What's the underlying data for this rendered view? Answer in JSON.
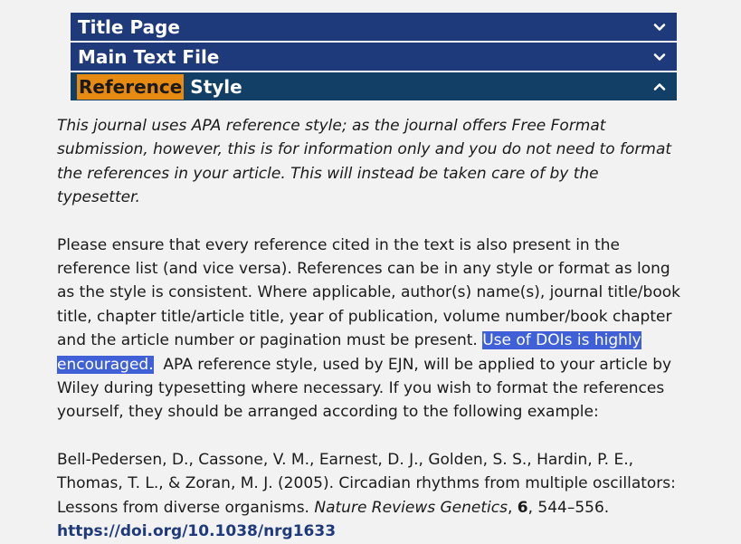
{
  "accordion": {
    "sections": [
      {
        "label": "Title Page",
        "state": "collapsed",
        "chevron": "chevron-down-icon"
      },
      {
        "label": "Main Text File",
        "state": "collapsed",
        "chevron": "chevron-down-icon"
      },
      {
        "label_highlight": "Reference",
        "label_rest": " Style",
        "state": "expanded",
        "chevron": "chevron-up-icon"
      }
    ]
  },
  "content": {
    "intro": "This journal uses APA reference style; as the journal offers Free Format submission, however, this is for information only and you do not need to format the references in your article. This will instead be taken care of by the typesetter.",
    "body_before": "Please ensure that every reference cited in the text is also present in the reference list (and vice versa). References can be in any style or format as long as the style is consistent. Where applicable, author(s) name(s), journal title/book title, chapter title/article title, year of publication, volume number/book chapter and the article number or pagination must be present. ",
    "body_highlight": "Use of DOIs is highly encouraged.",
    "body_after": "  APA reference style, used by EJN, will be applied to your article by Wiley during typesetting where necessary. If you wish to format the references yourself, they should be arranged according to the following example:",
    "reference": {
      "authors": "Bell-Pedersen, D., Cassone, V. M., Earnest, D. J., Golden, S. S., Hardin, P. E., Thomas, T. L., & Zoran, M. J. (2005). Circadian rhythms from multiple oscillators: Lessons from diverse organisms. ",
      "journal": "Nature Reviews Genetics",
      "sep1": ", ",
      "volume": "6",
      "pages": ", 544–556. ",
      "doi": "https://doi.org/10.1038/nrg1633"
    }
  },
  "colors": {
    "header_bg": "#1f3a7a",
    "header_open_bg": "#123f65",
    "highlight_orange": "#e68a12",
    "highlight_blue": "#3f60d6",
    "link": "#1f3a7a"
  }
}
